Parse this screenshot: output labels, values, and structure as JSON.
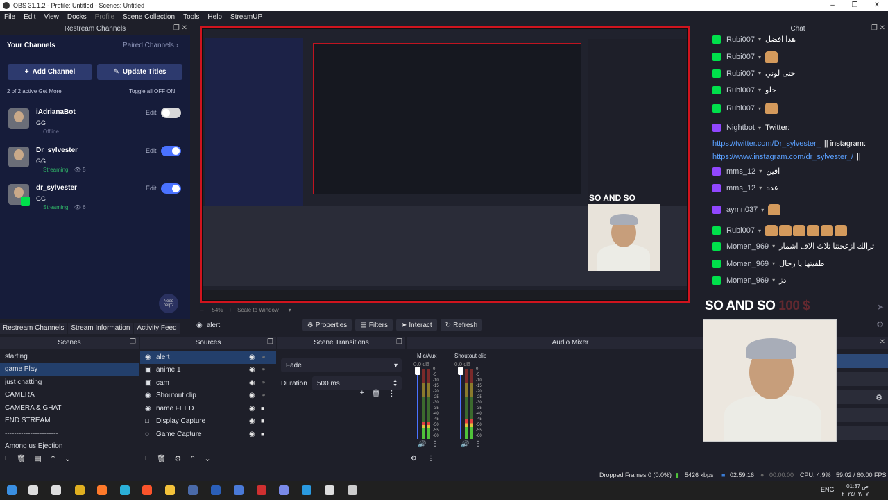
{
  "window": {
    "title": "OBS 31.1.2 - Profile: Untitled - Scenes: Untitled"
  },
  "menu": [
    "File",
    "Edit",
    "View",
    "Docks",
    "Profile",
    "Scene Collection",
    "Tools",
    "Help",
    "StreamUP"
  ],
  "restream": {
    "header": "Restream Channels",
    "your_channels": "Your Channels",
    "paired": "Paired Channels",
    "add_channel": "Add Channel",
    "update_titles": "Update Titles",
    "active_count": "2 of 2 active Get More",
    "toggle_all": "Toggle all OFF  ON",
    "need_help": "Need help?",
    "channels": [
      {
        "name": "iAdrianaBot",
        "title": "GG",
        "status": "Offline",
        "viewers": "",
        "edit": "Edit",
        "enabled": false
      },
      {
        "name": "Dr_sylvester",
        "title": "GG",
        "status": "Streaming",
        "viewers": "5",
        "edit": "Edit",
        "enabled": true
      },
      {
        "name": "dr_sylvester",
        "title": "GG",
        "status": "Streaming",
        "viewers": "6",
        "edit": "Edit",
        "enabled": true
      }
    ]
  },
  "preview": {
    "overlay_text": "SO AND SO",
    "zoom": "54%",
    "scale": "Scale to Window"
  },
  "toolbar": {
    "source": "alert",
    "properties": "Properties",
    "filters": "Filters",
    "interact": "Interact",
    "refresh": "Refresh"
  },
  "tabs": [
    "Restream Channels",
    "Stream Information",
    "Activity Feed"
  ],
  "scenes": {
    "header": "Scenes",
    "items": [
      "starting",
      "game Play",
      "just chatting",
      "CAMERA",
      "CAMERA & GHAT",
      "END STREAM",
      "-----------------------",
      "Among us Ejection"
    ],
    "selected": 1
  },
  "sources": {
    "header": "Sources",
    "items": [
      {
        "name": "alert",
        "icon": "globe-icon",
        "locked": false
      },
      {
        "name": "anime 1",
        "icon": "image-icon",
        "locked": false
      },
      {
        "name": "cam",
        "icon": "camera-icon",
        "locked": false
      },
      {
        "name": "Shoutout clip",
        "icon": "globe-icon",
        "locked": false
      },
      {
        "name": "name FEED",
        "icon": "globe-icon",
        "locked": true
      },
      {
        "name": "Display Capture",
        "icon": "monitor-icon",
        "locked": true
      },
      {
        "name": "Game Capture",
        "icon": "gamepad-icon",
        "locked": true
      }
    ],
    "selected": 0
  },
  "transitions": {
    "header": "Scene Transitions",
    "type": "Fade",
    "duration_label": "Duration",
    "duration": "500 ms"
  },
  "mixer": {
    "header": "Audio Mixer",
    "channels": [
      {
        "name": "Mic/Aux",
        "db": "0.0 dB",
        "level": 0.72
      },
      {
        "name": "Shoutout clip",
        "db": "0.0 dB",
        "level": 0.8
      }
    ],
    "scale": [
      "0",
      "-5",
      "-10",
      "-15",
      "-20",
      "-25",
      "-30",
      "-35",
      "-40",
      "-45",
      "-50",
      "-55",
      "-60"
    ]
  },
  "chat": {
    "header": "Chat",
    "messages": [
      {
        "user": "Rubi007",
        "platform": "kick",
        "text": "هذا افضل",
        "emote": 0
      },
      {
        "user": "Rubi007",
        "platform": "kick",
        "text": "",
        "emote": 1
      },
      {
        "user": "Rubi007",
        "platform": "kick",
        "text": "حتى لوني",
        "emote": 0
      },
      {
        "user": "Rubi007",
        "platform": "kick",
        "text": "حلو",
        "emote": 0
      },
      {
        "user": "Rubi007",
        "platform": "kick",
        "text": "",
        "emote": 1
      },
      {
        "user": "Nightbot",
        "platform": "twitch",
        "text": "Twitter:",
        "emote": 0
      },
      {
        "user": "mms_12",
        "platform": "twitch",
        "text": "اقين",
        "emote": 0
      },
      {
        "user": "mms_12",
        "platform": "twitch",
        "text": "عده",
        "emote": 0
      },
      {
        "user": "aymn037",
        "platform": "twitch",
        "text": "",
        "emote": 1
      },
      {
        "user": "Rubi007",
        "platform": "kick",
        "text": "",
        "emote": 6
      },
      {
        "user": "Momen_969",
        "platform": "kick",
        "text": "ترالك ازعجتنا ثلاث الاف اشمار",
        "emote": 0
      },
      {
        "user": "Momen_969",
        "platform": "kick",
        "text": "طفيتها يا رجال",
        "emote": 0
      },
      {
        "user": "Momen_969",
        "platform": "kick",
        "text": "دز",
        "emote": 0
      }
    ],
    "link1": "https://twitter.com/Dr_sylvester_",
    "link1_tail": "|| instagram:",
    "link2": "https://www.instagram.com/dr_sylvester_/",
    "link2_tail": "||",
    "overlay_text": "SO AND SO",
    "overlay_amount": "100 $"
  },
  "status": {
    "dropped": "Dropped Frames 0 (0.0%)",
    "kbps": "5426 kbps",
    "stream_time": "02:59:16",
    "rec_time": "00:00:00",
    "cpu": "CPU: 4.9%",
    "fps": "59.02 / 60.00 FPS"
  },
  "taskbar": {
    "lang": "ENG",
    "time": "01:37 ص",
    "date": "٢٠٢٤/٠٣/٠٧"
  }
}
